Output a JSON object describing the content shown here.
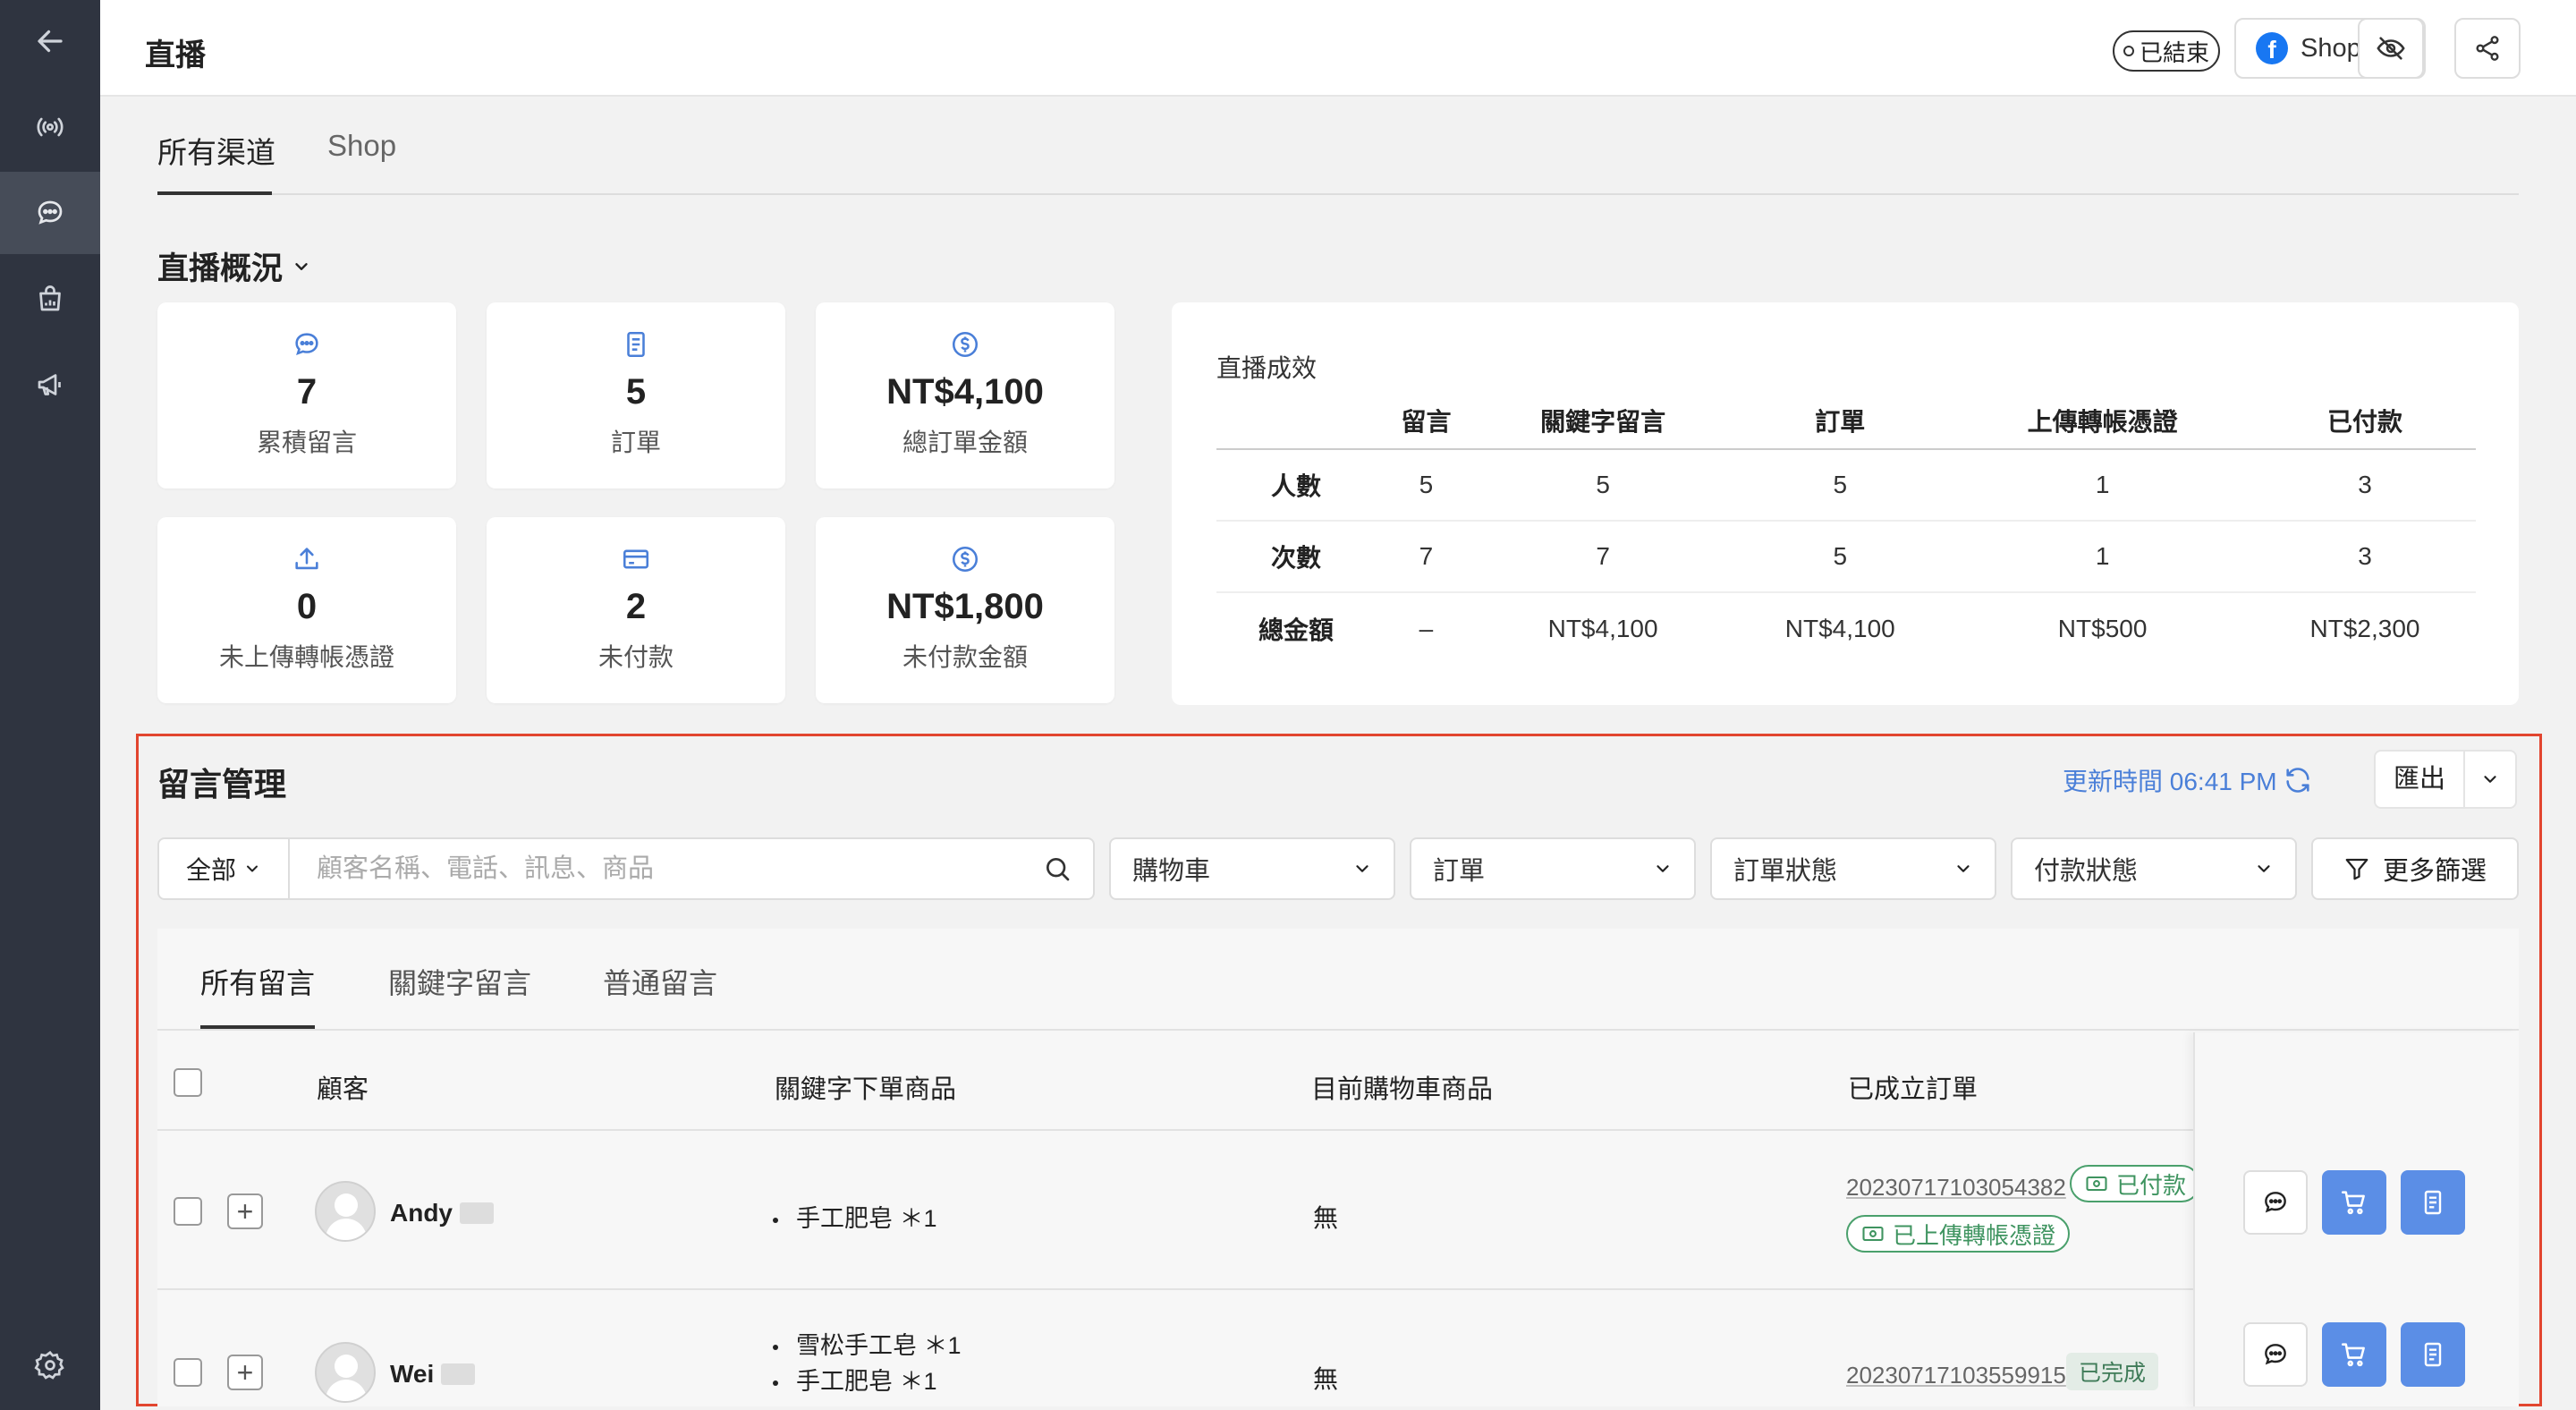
{
  "header": {
    "title": "直播",
    "status_badge": "已結束",
    "channel_button": "Shop"
  },
  "channel_tabs": [
    "所有渠道",
    "Shop"
  ],
  "overview": {
    "title": "直播概況",
    "stats": [
      {
        "icon": "chat-icon",
        "value": "7",
        "label": "累積留言"
      },
      {
        "icon": "order-icon",
        "value": "5",
        "label": "訂單"
      },
      {
        "icon": "dollar-icon",
        "value": "NT$4,100",
        "label": "總訂單金額"
      },
      {
        "icon": "upload-icon",
        "value": "0",
        "label": "未上傳轉帳憑證"
      },
      {
        "icon": "card-icon",
        "value": "2",
        "label": "未付款"
      },
      {
        "icon": "dollar-icon",
        "value": "NT$1,800",
        "label": "未付款金額"
      }
    ]
  },
  "performance": {
    "title": "直播成效",
    "columns": [
      "留言",
      "關鍵字留言",
      "訂單",
      "上傳轉帳憑證",
      "已付款"
    ],
    "rows": [
      {
        "label": "人數",
        "cells": [
          "5",
          "5",
          "5",
          "1",
          "3"
        ]
      },
      {
        "label": "次數",
        "cells": [
          "7",
          "7",
          "5",
          "1",
          "3"
        ]
      },
      {
        "label": "總金額",
        "cells": [
          "–",
          "NT$4,100",
          "NT$4,100",
          "NT$500",
          "NT$2,300"
        ]
      }
    ]
  },
  "comments": {
    "title": "留言管理",
    "update_time": "更新時間 06:41 PM",
    "export_label": "匯出",
    "scope": "全部",
    "search_placeholder": "顧客名稱、電話、訊息、商品",
    "filters": [
      "購物車",
      "訂單",
      "訂單狀態",
      "付款狀態"
    ],
    "more_filter": "更多篩選",
    "tabs": [
      "所有留言",
      "關鍵字留言",
      "普通留言"
    ],
    "columns": {
      "customer": "顧客",
      "keyword_products": "關鍵字下單商品",
      "cart_products": "目前購物車商品",
      "orders": "已成立訂單"
    },
    "rows": [
      {
        "name": "Andy",
        "products": [
          "手工肥皂 ＊1"
        ],
        "cart": "無",
        "order_no": "20230717103054382",
        "tags": [
          "已付款",
          "已上傳轉帳憑證"
        ]
      },
      {
        "name": "Wei",
        "products": [
          "雪松手工皂 ＊1",
          "手工肥皂 ＊1"
        ],
        "cart": "無",
        "order_no": "20230717103559915",
        "status": "已完成"
      }
    ]
  },
  "colors": {
    "sidebar": "#2f3440",
    "accent_blue": "#5b8ee6",
    "link_blue": "#4a7fd8",
    "highlight_frame": "#e2452f",
    "tag_green": "#4aa06c"
  }
}
